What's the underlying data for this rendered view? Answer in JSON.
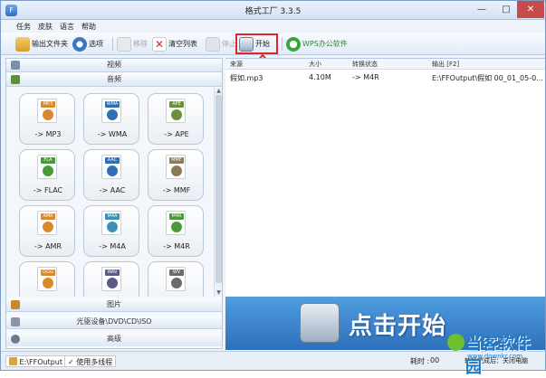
{
  "window": {
    "title": "格式工厂 3.3.5",
    "minimize": "—",
    "maximize": "□",
    "close": "✕"
  },
  "menu": [
    "任务",
    "皮肤",
    "语言",
    "帮助"
  ],
  "toolbar": {
    "output_folder": "输出文件夹",
    "options": "选项",
    "remove": "移除",
    "clear_list": "清空列表",
    "stop": "停止",
    "start": "开始",
    "wps": "WPS办公软件"
  },
  "left": {
    "cat_video": "视频",
    "cat_audio": "音频",
    "cat_image": "图片",
    "cat_disc": "光驱设备\\DVD\\CD\\ISO",
    "cat_advanced": "高级",
    "tiles": [
      {
        "badge": "MP3",
        "label": "-> MP3",
        "color": "#d9892b"
      },
      {
        "badge": "WMA",
        "label": "-> WMA",
        "color": "#2f6fb5"
      },
      {
        "badge": "APE",
        "label": "-> APE",
        "color": "#6b8f3a"
      },
      {
        "badge": "FLA",
        "label": "-> FLAC",
        "color": "#4a9a3a"
      },
      {
        "badge": "AAC",
        "label": "-> AAC",
        "color": "#2f6fb5"
      },
      {
        "badge": "MMF",
        "label": "-> MMF",
        "color": "#8a7a5a"
      },
      {
        "badge": "AMR",
        "label": "-> AMR",
        "color": "#d9892b"
      },
      {
        "badge": "M4A",
        "label": "-> M4A",
        "color": "#3c8fb5"
      },
      {
        "badge": "M4R",
        "label": "-> M4R",
        "color": "#4a9a3a"
      },
      {
        "badge": "OGG",
        "label": "",
        "color": "#d9892b"
      },
      {
        "badge": "WAV",
        "label": "",
        "color": "#5a5a8a"
      },
      {
        "badge": "WV",
        "label": "",
        "color": "#6b6b6b"
      }
    ]
  },
  "list": {
    "headers": [
      "来源",
      "大小",
      "转换状态",
      "输出 [F2]"
    ],
    "rows": [
      {
        "source": "假如.mp3",
        "size": "4.10M",
        "status": "-> M4R",
        "output": "E:\\FFOutput\\假如 00_01_05-0..."
      }
    ]
  },
  "banner": {
    "text": "点击开始"
  },
  "status": {
    "output_path": "E:\\FFOutput",
    "multithread": "使用多线程",
    "elapsed_label": "耗时 :",
    "elapsed_value": "00",
    "after_convert": "转换完成后：关闭电脑"
  },
  "watermark": {
    "brand": "当客软件园",
    "url": "www.downkr.com"
  },
  "colors": {
    "accent": "#2f6fba",
    "highlight": "#e0262b"
  }
}
